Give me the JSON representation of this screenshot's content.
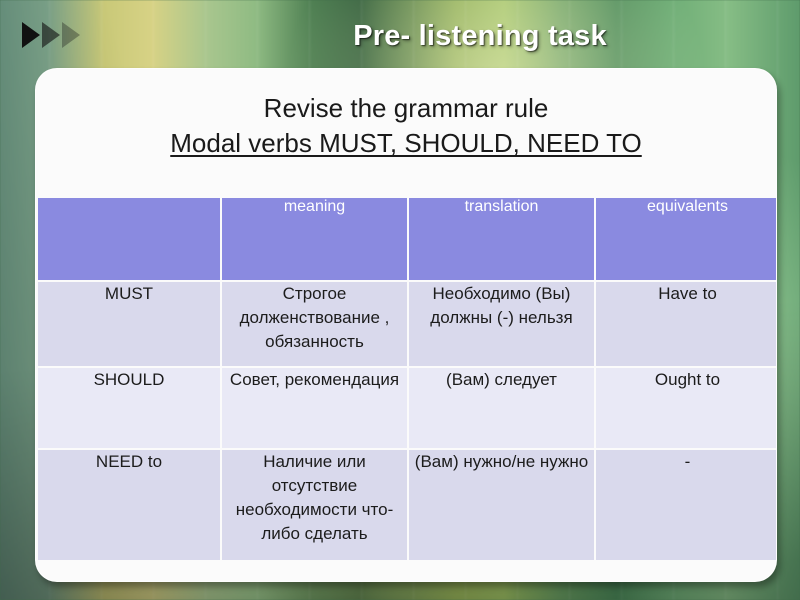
{
  "slide": {
    "title": "Pre- listening task",
    "accent_purple": "#8a8ae0",
    "row_color_odd": "#d9d9ec",
    "row_color_even": "#e9e9f6",
    "panel_color": "#fbfbfb",
    "title_color": "#ffffff"
  },
  "icons": {
    "arrow1": "play-triangle-icon",
    "arrow2": "play-triangle-icon",
    "arrow3": "play-triangle-icon"
  },
  "headings": {
    "line1": "Revise the grammar rule",
    "line2": "Modal verbs MUST, SHOULD, NEED TO"
  },
  "table": {
    "headers": [
      "",
      "meaning",
      "translation",
      "equivalents"
    ],
    "rows": [
      {
        "term": "MUST",
        "meaning": "Строгое долженствование , обязанность",
        "translation": "Необходимо (Вы) должны (-) нельзя",
        "equivalents": "Have to"
      },
      {
        "term": "SHOULD",
        "meaning": "Совет, рекомендация",
        "translation": "(Вам) следует",
        "equivalents": "Ought to"
      },
      {
        "term": "NEED to",
        "meaning": "Наличие или отсутствие необходимости что-либо сделать",
        "translation": "(Вам) нужно/не нужно",
        "equivalents": "-"
      }
    ]
  }
}
